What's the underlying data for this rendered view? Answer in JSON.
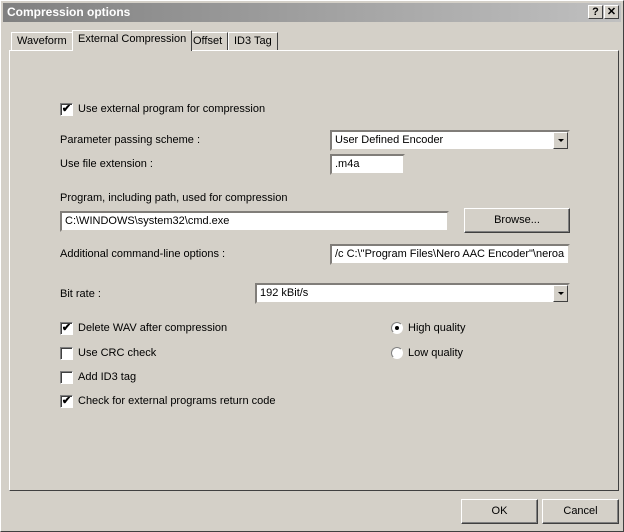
{
  "window": {
    "title": "Compression options",
    "help_label": "?",
    "close_label": "✕"
  },
  "tabs": [
    "Waveform",
    "External Compression",
    "Offset",
    "ID3 Tag"
  ],
  "active_tab": "External Compression",
  "options": {
    "use_external": {
      "label": "Use external program for compression",
      "checked": true
    },
    "parameter_scheme": {
      "label": "Parameter passing scheme :",
      "value": "User Defined Encoder"
    },
    "file_extension": {
      "label": "Use file extension :",
      "value": ".m4a"
    },
    "program_path": {
      "label": "Program, including path, used for compression",
      "value": "C:\\WINDOWS\\system32\\cmd.exe"
    },
    "browse_label": "Browse...",
    "additional_options": {
      "label": "Additional command-line options :",
      "value": "/c C:\\\"Program Files\\Nero AAC Encoder\"\\neroa"
    },
    "bit_rate": {
      "label": "Bit rate :",
      "value": "192 kBit/s"
    }
  },
  "checkboxes": [
    {
      "label": "Delete WAV after compression",
      "checked": true
    },
    {
      "label": "Use CRC check",
      "checked": false
    },
    {
      "label": "Add ID3 tag",
      "checked": false
    },
    {
      "label": "Check for external programs return code",
      "checked": true
    }
  ],
  "quality": {
    "options": [
      "High quality",
      "Low quality"
    ],
    "selected": "High quality"
  },
  "footer": {
    "ok_label": "OK",
    "cancel_label": "Cancel"
  },
  "check_glyph": "✔"
}
